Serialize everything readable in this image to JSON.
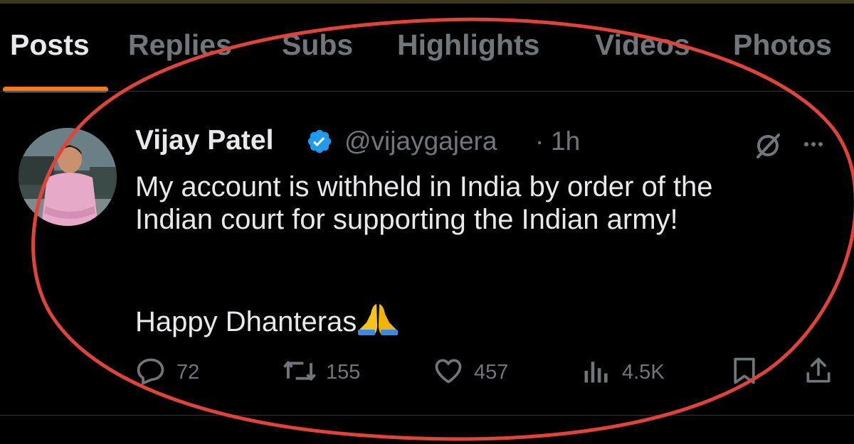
{
  "tabs": [
    {
      "label": "Posts",
      "active": true
    },
    {
      "label": "Replies"
    },
    {
      "label": "Subs"
    },
    {
      "label": "Highlights"
    },
    {
      "label": "Videos"
    },
    {
      "label": "Photos"
    }
  ],
  "tweet": {
    "author_name": "Vijay Patel",
    "handle": "@vijaygajera",
    "separator": "·",
    "time": "1h",
    "text_line1": "My account is withheld in India by order of the",
    "text_line2": "Indian court for supporting the Indian army!",
    "text_line3": "Happy Dhanteras",
    "emoji": "folded-hands-emoji"
  },
  "actions": {
    "replies": "72",
    "reposts": "155",
    "likes": "457",
    "views": "4.5K"
  },
  "colors": {
    "background": "#000000",
    "text": "#e7e9ea",
    "muted": "#71767b",
    "active_tab_underline": "#ff7a1a",
    "verified_badge": "#1d9bf0",
    "annotation_ellipse": "#e0433a"
  }
}
